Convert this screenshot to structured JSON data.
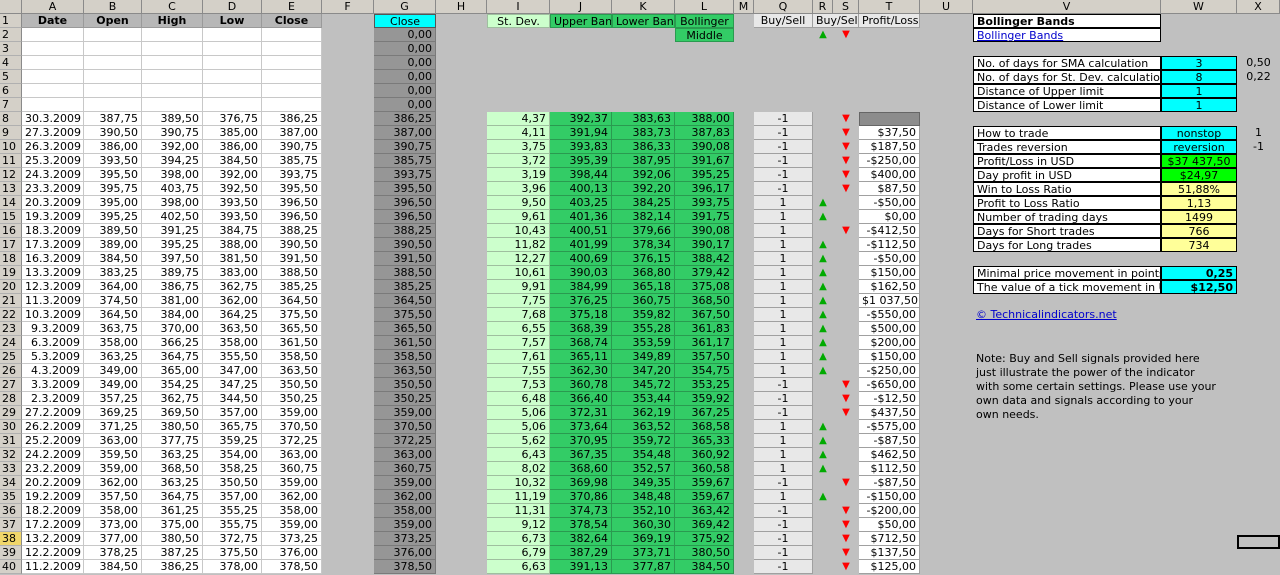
{
  "columns": [
    "A",
    "B",
    "C",
    "D",
    "E",
    "F",
    "G",
    "H",
    "I",
    "J",
    "K",
    "L",
    "M",
    "Q",
    "R",
    "S",
    "T",
    "U",
    "V",
    "W",
    "X"
  ],
  "headers": {
    "date": "Date",
    "open": "Open",
    "high": "High",
    "low": "Low",
    "close": "Close",
    "close_g": "Close",
    "stdev": "St. Dev.",
    "upper": "Upper Band",
    "lower": "Lower Band",
    "middle1": "Bollinger",
    "middle2": "Middle",
    "buysell_q": "Buy/Sell",
    "buysell_rs": "Buy/Sell",
    "pl": "Profit/Loss"
  },
  "header_arrows": {
    "up": "▲",
    "down": "▼"
  },
  "g_empty": [
    "0,00",
    "0,00",
    "0,00",
    "0,00",
    "0,00",
    "0,00"
  ],
  "rows": [
    {
      "n": "8",
      "date": "30.3.2009",
      "open": "387,75",
      "high": "389,50",
      "low": "376,75",
      "close": "386,25",
      "g": "386,25",
      "sd": "4,37",
      "ub": "392,37",
      "lb": "383,63",
      "mid": "388,00",
      "q": "-1",
      "arr": "down",
      "pl": ""
    },
    {
      "n": "9",
      "date": "27.3.2009",
      "open": "390,50",
      "high": "390,75",
      "low": "385,00",
      "close": "387,00",
      "g": "387,00",
      "sd": "4,11",
      "ub": "391,94",
      "lb": "383,73",
      "mid": "387,83",
      "q": "-1",
      "arr": "down",
      "pl": "$37,50"
    },
    {
      "n": "10",
      "date": "26.3.2009",
      "open": "386,00",
      "high": "392,00",
      "low": "386,00",
      "close": "390,75",
      "g": "390,75",
      "sd": "3,75",
      "ub": "393,83",
      "lb": "386,33",
      "mid": "390,08",
      "q": "-1",
      "arr": "down",
      "pl": "$187,50"
    },
    {
      "n": "11",
      "date": "25.3.2009",
      "open": "393,50",
      "high": "394,25",
      "low": "384,50",
      "close": "385,75",
      "g": "385,75",
      "sd": "3,72",
      "ub": "395,39",
      "lb": "387,95",
      "mid": "391,67",
      "q": "-1",
      "arr": "down",
      "pl": "-$250,00"
    },
    {
      "n": "12",
      "date": "24.3.2009",
      "open": "395,50",
      "high": "398,00",
      "low": "392,00",
      "close": "393,75",
      "g": "393,75",
      "sd": "3,19",
      "ub": "398,44",
      "lb": "392,06",
      "mid": "395,25",
      "q": "-1",
      "arr": "down",
      "pl": "$400,00"
    },
    {
      "n": "13",
      "date": "23.3.2009",
      "open": "395,75",
      "high": "403,75",
      "low": "392,50",
      "close": "395,50",
      "g": "395,50",
      "sd": "3,96",
      "ub": "400,13",
      "lb": "392,20",
      "mid": "396,17",
      "q": "-1",
      "arr": "down",
      "pl": "$87,50"
    },
    {
      "n": "14",
      "date": "20.3.2009",
      "open": "395,00",
      "high": "398,00",
      "low": "393,50",
      "close": "396,50",
      "g": "396,50",
      "sd": "9,50",
      "ub": "403,25",
      "lb": "384,25",
      "mid": "393,75",
      "q": "1",
      "arr": "up",
      "pl": "-$50,00"
    },
    {
      "n": "15",
      "date": "19.3.2009",
      "open": "395,25",
      "high": "402,50",
      "low": "393,50",
      "close": "396,50",
      "g": "396,50",
      "sd": "9,61",
      "ub": "401,36",
      "lb": "382,14",
      "mid": "391,75",
      "q": "1",
      "arr": "up",
      "pl": "$0,00"
    },
    {
      "n": "16",
      "date": "18.3.2009",
      "open": "389,50",
      "high": "391,25",
      "low": "384,75",
      "close": "388,25",
      "g": "388,25",
      "sd": "10,43",
      "ub": "400,51",
      "lb": "379,66",
      "mid": "390,08",
      "q": "1",
      "arr": "down",
      "pl": "-$412,50"
    },
    {
      "n": "17",
      "date": "17.3.2009",
      "open": "389,00",
      "high": "395,25",
      "low": "388,00",
      "close": "390,50",
      "g": "390,50",
      "sd": "11,82",
      "ub": "401,99",
      "lb": "378,34",
      "mid": "390,17",
      "q": "1",
      "arr": "up",
      "pl": "-$112,50"
    },
    {
      "n": "18",
      "date": "16.3.2009",
      "open": "384,50",
      "high": "397,50",
      "low": "381,50",
      "close": "391,50",
      "g": "391,50",
      "sd": "12,27",
      "ub": "400,69",
      "lb": "376,15",
      "mid": "388,42",
      "q": "1",
      "arr": "up",
      "pl": "-$50,00"
    },
    {
      "n": "19",
      "date": "13.3.2009",
      "open": "383,25",
      "high": "389,75",
      "low": "383,00",
      "close": "388,50",
      "g": "388,50",
      "sd": "10,61",
      "ub": "390,03",
      "lb": "368,80",
      "mid": "379,42",
      "q": "1",
      "arr": "up",
      "pl": "$150,00"
    },
    {
      "n": "20",
      "date": "12.3.2009",
      "open": "364,00",
      "high": "386,75",
      "low": "362,75",
      "close": "385,25",
      "g": "385,25",
      "sd": "9,91",
      "ub": "384,99",
      "lb": "365,18",
      "mid": "375,08",
      "q": "1",
      "arr": "up",
      "pl": "$162,50"
    },
    {
      "n": "21",
      "date": "11.3.2009",
      "open": "374,50",
      "high": "381,00",
      "low": "362,00",
      "close": "364,50",
      "g": "364,50",
      "sd": "7,75",
      "ub": "376,25",
      "lb": "360,75",
      "mid": "368,50",
      "q": "1",
      "arr": "up",
      "pl": "$1 037,50"
    },
    {
      "n": "22",
      "date": "10.3.2009",
      "open": "364,50",
      "high": "384,00",
      "low": "364,25",
      "close": "375,50",
      "g": "375,50",
      "sd": "7,68",
      "ub": "375,18",
      "lb": "359,82",
      "mid": "367,50",
      "q": "1",
      "arr": "up",
      "pl": "-$550,00"
    },
    {
      "n": "23",
      "date": "9.3.2009",
      "open": "363,75",
      "high": "370,00",
      "low": "363,50",
      "close": "365,50",
      "g": "365,50",
      "sd": "6,55",
      "ub": "368,39",
      "lb": "355,28",
      "mid": "361,83",
      "q": "1",
      "arr": "up",
      "pl": "$500,00"
    },
    {
      "n": "24",
      "date": "6.3.2009",
      "open": "358,00",
      "high": "366,25",
      "low": "358,00",
      "close": "361,50",
      "g": "361,50",
      "sd": "7,57",
      "ub": "368,74",
      "lb": "353,59",
      "mid": "361,17",
      "q": "1",
      "arr": "up",
      "pl": "$200,00"
    },
    {
      "n": "25",
      "date": "5.3.2009",
      "open": "363,25",
      "high": "364,75",
      "low": "355,50",
      "close": "358,50",
      "g": "358,50",
      "sd": "7,61",
      "ub": "365,11",
      "lb": "349,89",
      "mid": "357,50",
      "q": "1",
      "arr": "up",
      "pl": "$150,00"
    },
    {
      "n": "26",
      "date": "4.3.2009",
      "open": "349,00",
      "high": "365,00",
      "low": "347,00",
      "close": "363,50",
      "g": "363,50",
      "sd": "7,55",
      "ub": "362,30",
      "lb": "347,20",
      "mid": "354,75",
      "q": "1",
      "arr": "up",
      "pl": "-$250,00"
    },
    {
      "n": "27",
      "date": "3.3.2009",
      "open": "349,00",
      "high": "354,25",
      "low": "347,25",
      "close": "350,50",
      "g": "350,50",
      "sd": "7,53",
      "ub": "360,78",
      "lb": "345,72",
      "mid": "353,25",
      "q": "-1",
      "arr": "down",
      "pl": "-$650,00"
    },
    {
      "n": "28",
      "date": "2.3.2009",
      "open": "357,25",
      "high": "362,75",
      "low": "344,50",
      "close": "350,25",
      "g": "350,25",
      "sd": "6,48",
      "ub": "366,40",
      "lb": "353,44",
      "mid": "359,92",
      "q": "-1",
      "arr": "down",
      "pl": "-$12,50"
    },
    {
      "n": "29",
      "date": "27.2.2009",
      "open": "369,25",
      "high": "369,50",
      "low": "357,00",
      "close": "359,00",
      "g": "359,00",
      "sd": "5,06",
      "ub": "372,31",
      "lb": "362,19",
      "mid": "367,25",
      "q": "-1",
      "arr": "down",
      "pl": "$437,50"
    },
    {
      "n": "30",
      "date": "26.2.2009",
      "open": "371,25",
      "high": "380,50",
      "low": "365,75",
      "close": "370,50",
      "g": "370,50",
      "sd": "5,06",
      "ub": "373,64",
      "lb": "363,52",
      "mid": "368,58",
      "q": "1",
      "arr": "up",
      "pl": "-$575,00"
    },
    {
      "n": "31",
      "date": "25.2.2009",
      "open": "363,00",
      "high": "377,75",
      "low": "359,25",
      "close": "372,25",
      "g": "372,25",
      "sd": "5,62",
      "ub": "370,95",
      "lb": "359,72",
      "mid": "365,33",
      "q": "1",
      "arr": "up",
      "pl": "-$87,50"
    },
    {
      "n": "32",
      "date": "24.2.2009",
      "open": "359,50",
      "high": "363,25",
      "low": "354,00",
      "close": "363,00",
      "g": "363,00",
      "sd": "6,43",
      "ub": "367,35",
      "lb": "354,48",
      "mid": "360,92",
      "q": "1",
      "arr": "up",
      "pl": "$462,50"
    },
    {
      "n": "33",
      "date": "23.2.2009",
      "open": "359,00",
      "high": "368,50",
      "low": "358,25",
      "close": "360,75",
      "g": "360,75",
      "sd": "8,02",
      "ub": "368,60",
      "lb": "352,57",
      "mid": "360,58",
      "q": "1",
      "arr": "up",
      "pl": "$112,50"
    },
    {
      "n": "34",
      "date": "20.2.2009",
      "open": "362,00",
      "high": "363,25",
      "low": "350,50",
      "close": "359,00",
      "g": "359,00",
      "sd": "10,32",
      "ub": "369,98",
      "lb": "349,35",
      "mid": "359,67",
      "q": "-1",
      "arr": "down",
      "pl": "-$87,50"
    },
    {
      "n": "35",
      "date": "19.2.2009",
      "open": "357,50",
      "high": "364,75",
      "low": "357,00",
      "close": "362,00",
      "g": "362,00",
      "sd": "11,19",
      "ub": "370,86",
      "lb": "348,48",
      "mid": "359,67",
      "q": "1",
      "arr": "up",
      "pl": "-$150,00"
    },
    {
      "n": "36",
      "date": "18.2.2009",
      "open": "358,00",
      "high": "361,25",
      "low": "355,25",
      "close": "358,00",
      "g": "358,00",
      "sd": "11,31",
      "ub": "374,73",
      "lb": "352,10",
      "mid": "363,42",
      "q": "-1",
      "arr": "down",
      "pl": "-$200,00"
    },
    {
      "n": "37",
      "date": "17.2.2009",
      "open": "373,00",
      "high": "375,00",
      "low": "355,75",
      "close": "359,00",
      "g": "359,00",
      "sd": "9,12",
      "ub": "378,54",
      "lb": "360,30",
      "mid": "369,42",
      "q": "-1",
      "arr": "down",
      "pl": "$50,00"
    },
    {
      "n": "38",
      "date": "13.2.2009",
      "open": "377,00",
      "high": "380,50",
      "low": "372,75",
      "close": "373,25",
      "g": "373,25",
      "sd": "6,73",
      "ub": "382,64",
      "lb": "369,19",
      "mid": "375,92",
      "q": "-1",
      "arr": "down",
      "pl": "$712,50"
    },
    {
      "n": "39",
      "date": "12.2.2009",
      "open": "378,25",
      "high": "387,25",
      "low": "375,50",
      "close": "376,00",
      "g": "376,00",
      "sd": "6,79",
      "ub": "387,29",
      "lb": "373,71",
      "mid": "380,50",
      "q": "-1",
      "arr": "down",
      "pl": "$137,50"
    },
    {
      "n": "40",
      "date": "11.2.2009",
      "open": "384,50",
      "high": "386,25",
      "low": "378,00",
      "close": "378,50",
      "g": "378,50",
      "sd": "6,63",
      "ub": "391,13",
      "lb": "377,87",
      "mid": "384,50",
      "q": "-1",
      "arr": "down",
      "pl": "$125,00"
    }
  ],
  "panel": {
    "title": "Bollinger Bands",
    "title_link": "Bollinger Bands",
    "params": [
      {
        "label": "No. of days for SMA calculation",
        "value": "3",
        "x": "0,50"
      },
      {
        "label": "No. of days for St. Dev. calculation",
        "value": "8",
        "x": "0,22"
      },
      {
        "label": "Distance of Upper limit",
        "value": "1",
        "x": ""
      },
      {
        "label": "Distance of Lower limit",
        "value": "1",
        "x": ""
      }
    ],
    "stats": [
      {
        "label": "How to trade",
        "value": "nonstop",
        "style": "cyan",
        "x": "1"
      },
      {
        "label": "Trades reversion",
        "value": "reversion",
        "style": "cyan",
        "x": "-1"
      },
      {
        "label": "Profit/Loss in USD",
        "value": "$37 437,50",
        "style": "green",
        "x": ""
      },
      {
        "label": "Day profit in USD",
        "value": "$24,97",
        "style": "green",
        "x": ""
      },
      {
        "label": "Win to Loss Ratio",
        "value": "51,88%",
        "style": "yellow",
        "x": ""
      },
      {
        "label": "Profit to Loss Ratio",
        "value": "1,13",
        "style": "yellow",
        "x": ""
      },
      {
        "label": "Number of trading days",
        "value": "1499",
        "style": "yellow",
        "x": ""
      },
      {
        "label": "Days for Short trades",
        "value": "766",
        "style": "yellow",
        "x": ""
      },
      {
        "label": "Days for Long trades",
        "value": "734",
        "style": "yellow",
        "x": ""
      }
    ],
    "tick": [
      {
        "label": "Minimal price movement in points",
        "value": "0,25"
      },
      {
        "label": "The value of a tick movement in USD",
        "value": "$12,50"
      }
    ],
    "site_link": "© Technicalindicators.net",
    "note": "Note: Buy and Sell signals provided here just illustrate the power of the indicator with some certain settings. Please use your own data and signals according to your own needs."
  },
  "colors": {
    "header_gray": "#d4d0c8",
    "cyan": "#00ffff",
    "green": "#33cc66",
    "light_green": "#ccffcc",
    "yellow": "#ffff99",
    "up": "#00aa00",
    "down": "#ff0000"
  }
}
